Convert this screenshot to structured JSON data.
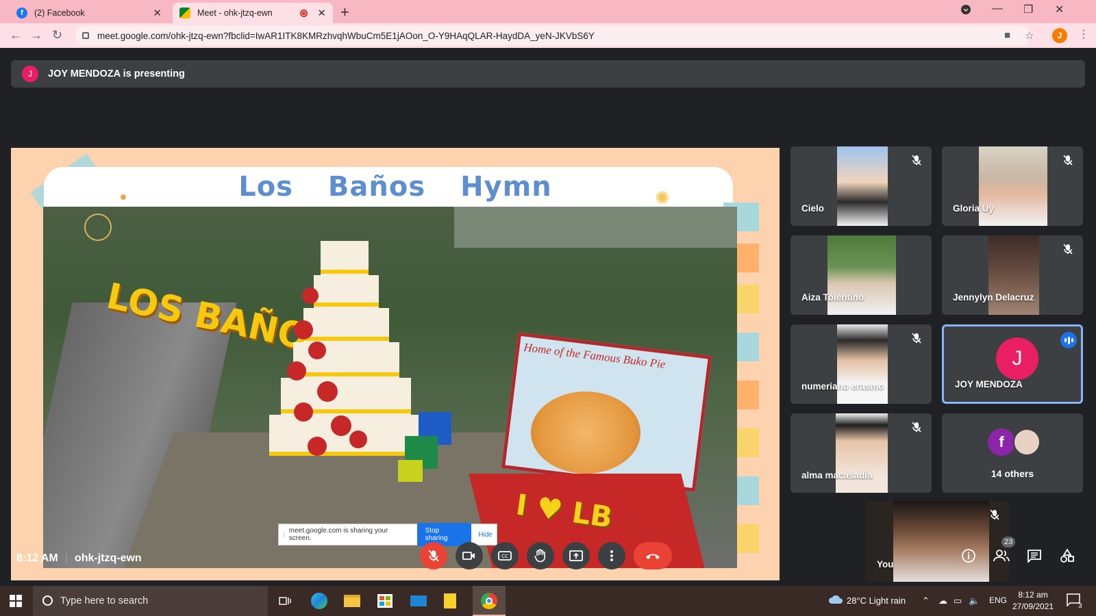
{
  "browser": {
    "tabs": [
      {
        "title": "(2) Facebook",
        "active": false
      },
      {
        "title": "Meet - ohk-jtzq-ewn",
        "active": true
      }
    ],
    "url": "meet.google.com/ohk-jtzq-ewn?fbclid=IwAR1ITK8KMRzhvqhWbuCm5E1jAOon_O-Y9HAqQLAR-HaydDA_yeN-JKVbS6Y",
    "profile_initial": "J"
  },
  "meet": {
    "presenter_initial": "J",
    "presenting_text": "JOY MENDOZA is presenting",
    "slide": {
      "title": "Los Baños Hymn",
      "photo_sign_text": "LOS BAÑOS",
      "photo_board_text": "Home of the Famous Buko Pie",
      "photo_stage_text": "I ♥ LB"
    },
    "share_banner": {
      "message": "meet.google.com is sharing your screen.",
      "stop_label": "Stop sharing",
      "hide_label": "Hide"
    },
    "participants": [
      {
        "name": "Cielo",
        "muted": true
      },
      {
        "name": "Gloria Uy",
        "muted": true
      },
      {
        "name": "Aiza Tolentino",
        "muted": false
      },
      {
        "name": "Jennylyn Delacruz",
        "muted": true
      },
      {
        "name": "numeriano erasmo",
        "muted": true
      },
      {
        "name": "JOY MENDOZA",
        "initial": "J",
        "speaking": true
      },
      {
        "name": "alma macasadia",
        "muted": true
      }
    ],
    "others": {
      "initial": "f",
      "label": "14 others"
    },
    "self_tile": {
      "name": "You",
      "muted": true
    },
    "footer": {
      "time": "8:12 AM",
      "meeting_code": "ohk-jtzq-ewn",
      "people_count": "23"
    }
  },
  "taskbar": {
    "search_placeholder": "Type here to search",
    "weather": "28°C  Light rain",
    "language": "ENG",
    "time": "8:12 am",
    "date": "27/09/2021",
    "notifications": "3"
  }
}
